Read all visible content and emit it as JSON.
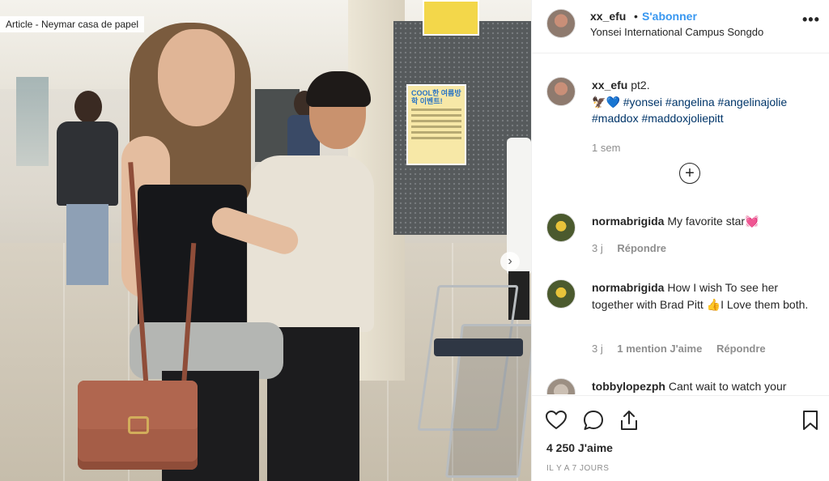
{
  "photo": {
    "article_label": "Article - Neymar casa de papel",
    "poster_text": "COOL한 여름방학 이벤트!"
  },
  "header": {
    "username": "xx_efu",
    "separator": "•",
    "follow_label": "S'abonner",
    "location": "Yonsei International Campus Songdo",
    "more_label": "•••"
  },
  "caption": {
    "username": "xx_efu",
    "text": "pt2.",
    "emojis": [
      "🦅",
      "💙"
    ],
    "hashtags": [
      "#yonsei",
      "#angelina",
      "#angelinajolie",
      "#maddox",
      "#maddoxjoliepitt"
    ],
    "time": "1 sem"
  },
  "load_more_label": "+",
  "comments": [
    {
      "username": "normabrigida",
      "text": "My favorite star",
      "emoji": "💓",
      "time": "3 j",
      "reply_label": "Répondre"
    },
    {
      "username": "normabrigida",
      "text_before": "How I wish To see her together with Brad Pitt",
      "emoji": "👍",
      "text_after": "I Love them both.",
      "time": "3 j",
      "likes_label": "1 mention J'aime",
      "reply_label": "Répondre"
    },
    {
      "username": "tobbylopezph",
      "text": "Cant wait to watch your"
    }
  ],
  "actions": {
    "like_count": "4 250 J'aime",
    "posted_ago": "IL Y A 7 JOURS"
  },
  "colors": {
    "follow_blue": "#3897f0",
    "hashtag": "#003569",
    "muted": "#8e8e8e",
    "text": "#262626"
  }
}
